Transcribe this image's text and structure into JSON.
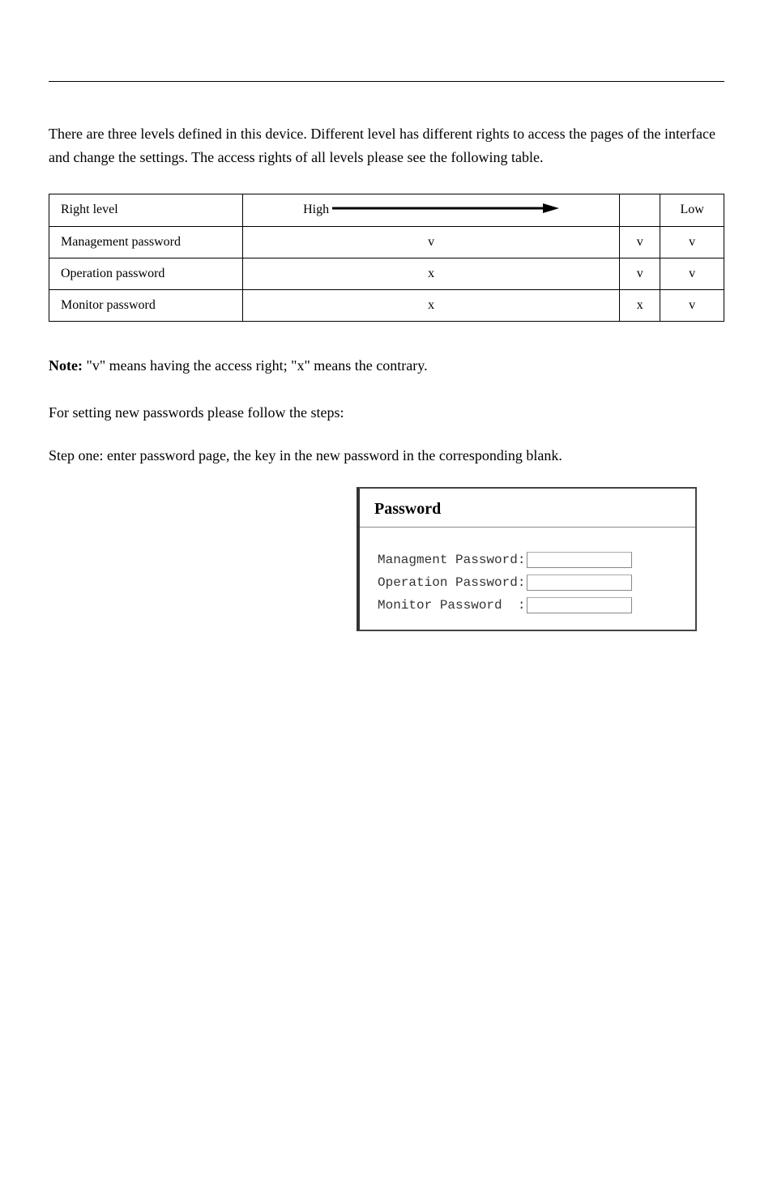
{
  "headerRulePresent": true,
  "para1": "There are three levels defined in this device. Different level has different rights to access the pages of the interface and change the settings. The access rights of all levels please see the following table.",
  "table": {
    "header": {
      "col1": "Right level",
      "col2": "High",
      "col4": "Low"
    },
    "rows": [
      {
        "label": "Management password",
        "c2": "v",
        "c3": "v",
        "c4": "v"
      },
      {
        "label": "Operation password",
        "c2": "x",
        "c3": "v",
        "c4": "v"
      },
      {
        "label": "Monitor password",
        "c2": "x",
        "c3": "x",
        "c4": "v"
      }
    ]
  },
  "note_label": "Note:",
  "note_text": " \"v\" means having the access right; \"x\" means the contrary.",
  "steps_para": "For setting new passwords please follow the steps:",
  "step1": "Step one: enter password page, the key in the new password in the corresponding blank.",
  "figure": {
    "title": "Password",
    "fields": [
      {
        "label": "Managment Password:",
        "name": "management-password-input"
      },
      {
        "label": "Operation Password:",
        "name": "operation-password-input"
      },
      {
        "label": "Monitor Password  :",
        "name": "monitor-password-input"
      }
    ]
  }
}
